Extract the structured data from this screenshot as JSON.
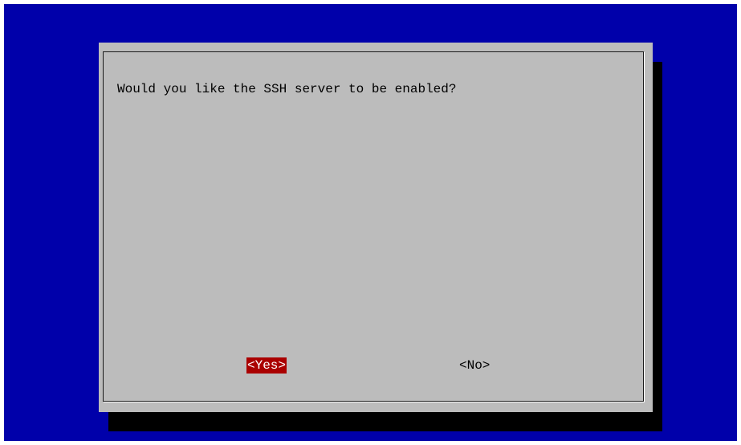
{
  "dialog": {
    "question": "Would you like the SSH server to be enabled?",
    "buttons": [
      {
        "label": "<Yes>",
        "selected": true
      },
      {
        "label": "<No>",
        "selected": false
      }
    ]
  },
  "colors": {
    "background": "#0000aa",
    "dialog": "#bcbcbc",
    "selected_button": "#aa0000",
    "shadow": "#000000"
  }
}
